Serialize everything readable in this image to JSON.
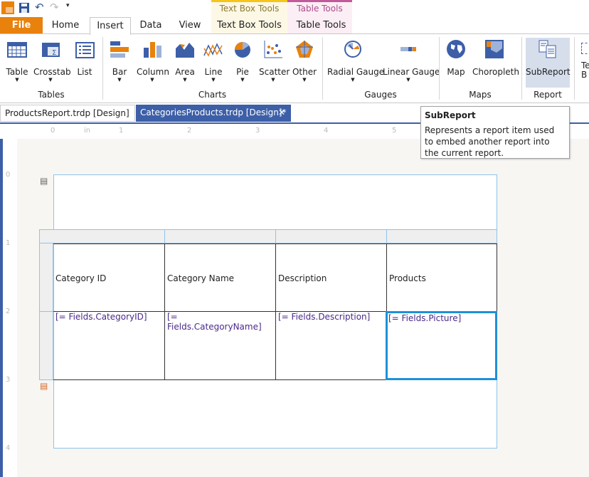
{
  "window": {
    "qat_icons": [
      "app-logo-icon",
      "save-icon",
      "undo-icon",
      "redo-icon",
      "customize-icon"
    ]
  },
  "context_tabs": {
    "text_box_tools": "Text Box Tools",
    "table_tools": "Table Tools",
    "text_box_color": "#f5c518",
    "table_color": "#c15a9a"
  },
  "tabs": {
    "file": "File",
    "home": "Home",
    "insert": "Insert",
    "data": "Data",
    "view": "View",
    "text_box_tools": "Text Box Tools",
    "table_tools": "Table Tools",
    "active": "Insert"
  },
  "ribbon": {
    "tables": {
      "label": "Tables",
      "items": [
        "Table",
        "Crosstab",
        "List"
      ]
    },
    "charts": {
      "label": "Charts",
      "items": [
        "Bar",
        "Column",
        "Area",
        "Line",
        "Pie",
        "Scatter",
        "Other"
      ]
    },
    "gauges": {
      "label": "Gauges",
      "items": [
        "Radial Gauge",
        "Linear Gauge"
      ]
    },
    "maps": {
      "label": "Maps",
      "items": [
        "Map",
        "Choropleth"
      ]
    },
    "report": {
      "label": "Report",
      "items": [
        "SubReport"
      ]
    },
    "partial": {
      "line1": "Te",
      "line2": "B"
    }
  },
  "doc_tabs": [
    {
      "label": "ProductsReport.trdp [Design]"
    },
    {
      "label": "CategoriesProducts.trdp [Design]*",
      "active": true
    }
  ],
  "ruler": {
    "unit": "in",
    "ticks": [
      "0",
      "1",
      "2",
      "3",
      "4",
      "5"
    ],
    "vticks": [
      "0",
      "1",
      "2",
      "3",
      "4"
    ]
  },
  "tooltip": {
    "title": "SubReport",
    "body": "Represents a report item used to embed another report into the current report."
  },
  "table": {
    "headers": [
      "Category ID",
      "Category Name",
      "Description",
      "Products"
    ],
    "fields": [
      "[= Fields.CategoryID]",
      "[= Fields.CategoryName]",
      "[= Fields.Description]",
      "[= Fields.Picture]"
    ]
  }
}
